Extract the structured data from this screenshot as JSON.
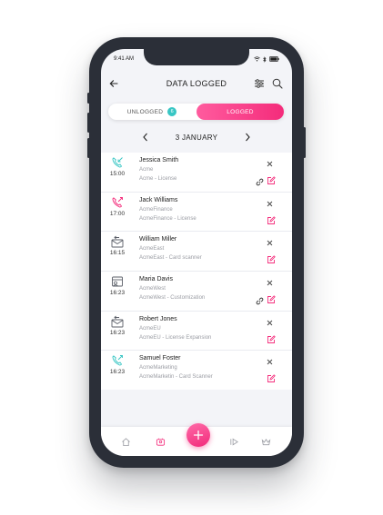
{
  "status": {
    "time": "9:41 AM"
  },
  "header": {
    "title": "DATA LOGGED"
  },
  "toggle": {
    "unlogged_label": "UNLOGGED",
    "unlogged_count": "6",
    "logged_label": "LOGGED",
    "active": "logged"
  },
  "date": {
    "label": "3 JANUARY"
  },
  "colors": {
    "accent": "#f42c7b",
    "teal": "#38c6c4",
    "icon_gray": "#5b5f68"
  },
  "entries": [
    {
      "icon": "phone-incoming-icon",
      "icon_color": "#38c6c4",
      "time": "15:00",
      "name": "Jessica Smith",
      "company": "Acme",
      "subject": "Acme - License",
      "attachment": true
    },
    {
      "icon": "phone-outgoing-icon",
      "icon_color": "#f42c7b",
      "time": "17:00",
      "name": "Jack Williams",
      "company": "AcmeFinance",
      "subject": "AcmeFinance - License",
      "attachment": false
    },
    {
      "icon": "email-icon",
      "icon_color": "#5b5f68",
      "time": "16:15",
      "name": "William Miller",
      "company": "AcmeEast",
      "subject": "AcmeEast - Card scanner",
      "attachment": false
    },
    {
      "icon": "meeting-icon",
      "icon_color": "#5b5f68",
      "time": "16:23",
      "name": "Maria Davis",
      "company": "AcmeWest",
      "subject": "AcmeWest - Customization",
      "attachment": true
    },
    {
      "icon": "email-icon",
      "icon_color": "#5b5f68",
      "time": "16:23",
      "name": "Robert Jones",
      "company": "AcmeEU",
      "subject": "AcmeEU - License Expansion",
      "attachment": false
    },
    {
      "icon": "phone-outgoing-icon",
      "icon_color": "#38c6c4",
      "time": "16:23",
      "name": "Samuel Foster",
      "company": "AcmeMarketing",
      "subject": "AcmeMarketin - Card Scanner",
      "attachment": false
    }
  ],
  "tabbar": {
    "items": [
      {
        "icon": "home-icon"
      },
      {
        "icon": "contacts-icon",
        "active": true
      },
      {
        "icon": "add-icon"
      },
      {
        "icon": "forward-icon"
      },
      {
        "icon": "crown-icon"
      }
    ]
  }
}
